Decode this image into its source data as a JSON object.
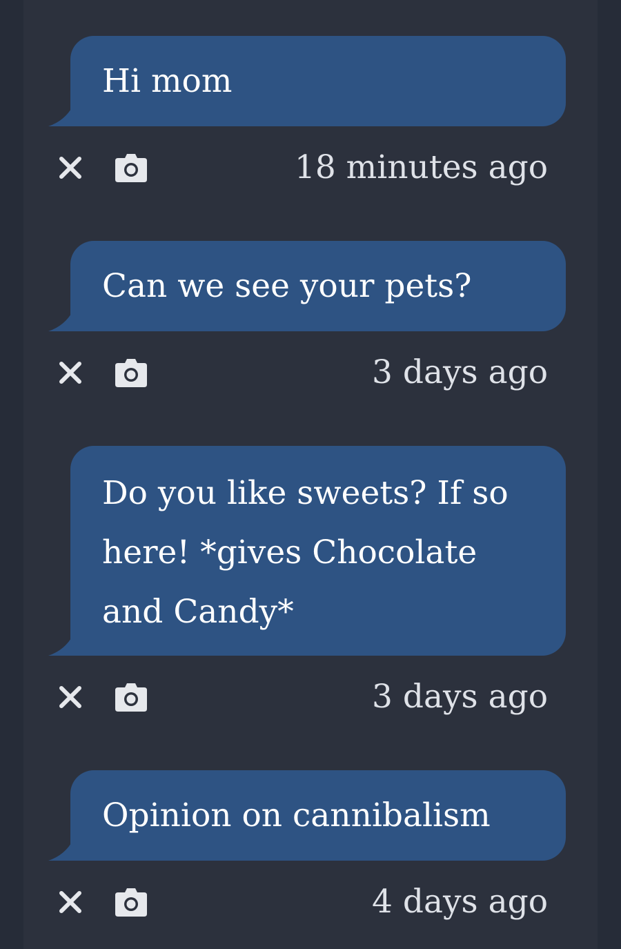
{
  "messages": [
    {
      "text": "Hi mom",
      "timestamp": "18 minutes ago"
    },
    {
      "text": "Can we see your pets?",
      "timestamp": "3 days ago"
    },
    {
      "text": "Do you like sweets? If so here! *gives Chocolate and Candy*",
      "timestamp": "3 days ago"
    },
    {
      "text": "Opinion on cannibalism",
      "timestamp": "4 days ago"
    }
  ],
  "icons": {
    "delete": "close-icon",
    "photo": "camera-icon"
  },
  "colors": {
    "background": "#262c38",
    "column": "#2c313d",
    "bubble": "#2e5383",
    "text": "#ffffff",
    "timestamp": "#dfe2e8",
    "icon": "#e6e8ec"
  }
}
